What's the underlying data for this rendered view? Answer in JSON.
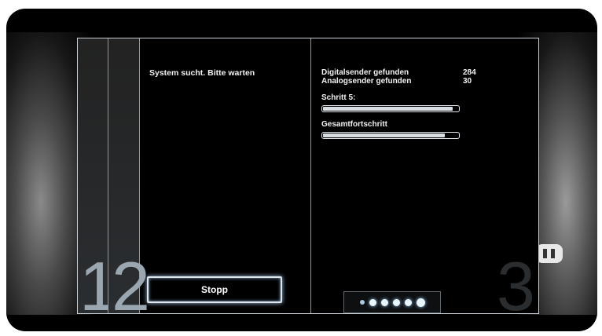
{
  "wizard": {
    "step_tabs": [
      "1",
      "2"
    ],
    "next_step": "3"
  },
  "left_panel": {
    "status_text": "System sucht. Bitte warten",
    "stop_button": "Stopp"
  },
  "right_panel": {
    "digital_label": "Digitalsender gefunden",
    "digital_value": "284",
    "analog_label": "Analogsender gefunden",
    "analog_value": "30",
    "step_label": "Schritt 5:",
    "step_progress": 0.97,
    "total_label": "Gesamtfortschritt",
    "total_progress": 0.91
  },
  "page_indicator": {
    "dot_count": 6,
    "active_index": 5
  }
}
